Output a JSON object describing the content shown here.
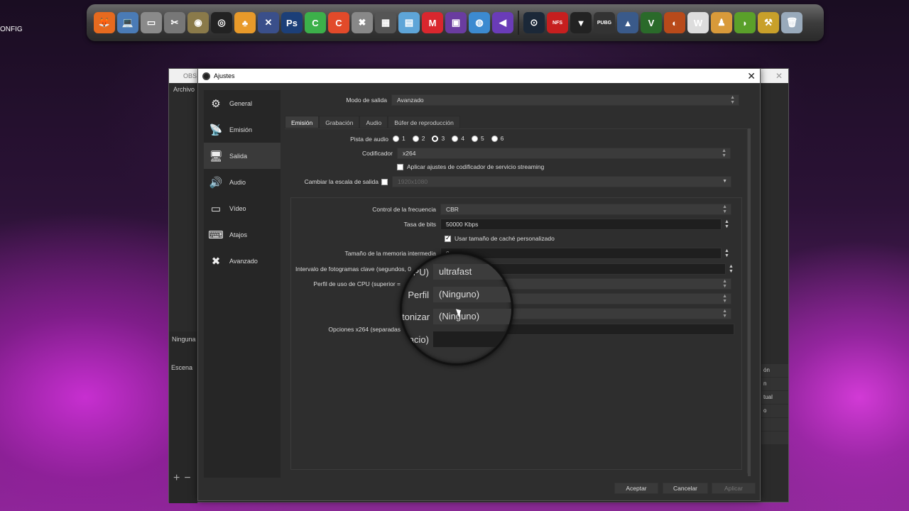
{
  "desktop": {
    "label": "ONFIG"
  },
  "dock": {
    "icons": [
      {
        "name": "firefox-icon",
        "glyph": "🦊",
        "color": "#e66a1f"
      },
      {
        "name": "laptop-icon",
        "glyph": "💻",
        "color": "#4a7bb6"
      },
      {
        "name": "drive-icon",
        "glyph": "▭",
        "color": "#8a8a8a"
      },
      {
        "name": "tools-icon",
        "glyph": "✂",
        "color": "#777"
      },
      {
        "name": "coin-icon",
        "glyph": "◉",
        "color": "#8a7a4a"
      },
      {
        "name": "obs-icon",
        "glyph": "◎",
        "color": "#222"
      },
      {
        "name": "fl-studio-icon",
        "glyph": "♣",
        "color": "#e89a2a"
      },
      {
        "name": "directx-icon",
        "glyph": "✕",
        "color": "#3a4f8a"
      },
      {
        "name": "photoshop-icon",
        "glyph": "Ps",
        "color": "#1c3f78"
      },
      {
        "name": "camtasia-icon",
        "glyph": "C",
        "color": "#3cb04a"
      },
      {
        "name": "camtasia-red-icon",
        "glyph": "C",
        "color": "#e24a2a"
      },
      {
        "name": "wrench-icon",
        "glyph": "✖",
        "color": "#888"
      },
      {
        "name": "gpu-icon",
        "glyph": "▦",
        "color": "#555"
      },
      {
        "name": "id-card-icon",
        "glyph": "▤",
        "color": "#5ea5d8"
      },
      {
        "name": "mega-icon",
        "glyph": "M",
        "color": "#d9272e"
      },
      {
        "name": "cpu-icon",
        "glyph": "▣",
        "color": "#6a3ca0"
      },
      {
        "name": "earth-icon",
        "glyph": "◍",
        "color": "#3c8ad0"
      },
      {
        "name": "visual-studio-icon",
        "glyph": "◀",
        "color": "#6a3cb8"
      },
      {
        "name": "steam-icon",
        "glyph": "⊙",
        "color": "#1b2838"
      },
      {
        "name": "nfs-icon",
        "glyph": "NFS",
        "color": "#c61f1f"
      },
      {
        "name": "fox-mask-icon",
        "glyph": "▼",
        "color": "#222"
      },
      {
        "name": "pubg-icon",
        "glyph": "PUBG",
        "color": "#333"
      },
      {
        "name": "assassins-creed-icon",
        "glyph": "▲",
        "color": "#3a5a8a"
      },
      {
        "name": "gta-icon",
        "glyph": "V",
        "color": "#2a6a2a"
      },
      {
        "name": "watch-dogs-icon",
        "glyph": "◐",
        "color": "#b84a1a"
      },
      {
        "name": "wolf-icon",
        "glyph": "W",
        "color": "#ddd"
      },
      {
        "name": "cs-icon",
        "glyph": "♟",
        "color": "#d89a3a"
      },
      {
        "name": "nvidia-icon",
        "glyph": "◗",
        "color": "#5aa02a"
      },
      {
        "name": "hammer-icon",
        "glyph": "⚒",
        "color": "#c8a02a"
      },
      {
        "name": "recycle-bin-icon",
        "glyph": "🗑",
        "color": "#9ab"
      }
    ]
  },
  "obs": {
    "title": "OBS",
    "menu_archivo": "Archivo",
    "ninguna": "Ninguna",
    "escena": "Escena",
    "right_items": [
      "ón",
      "n",
      "tual",
      "o",
      "",
      ""
    ]
  },
  "settings": {
    "title": "Ajustes",
    "categories": [
      {
        "label": "General",
        "icon": "gear-icon",
        "glyph": "⚙"
      },
      {
        "label": "Emisión",
        "icon": "broadcast-icon",
        "glyph": "📡"
      },
      {
        "label": "Salida",
        "icon": "monitor-output-icon",
        "glyph": "🖥"
      },
      {
        "label": "Audio",
        "icon": "speaker-icon",
        "glyph": "🔊"
      },
      {
        "label": "Vídeo",
        "icon": "display-icon",
        "glyph": "▭"
      },
      {
        "label": "Atajos",
        "icon": "keyboard-icon",
        "glyph": "⌨"
      },
      {
        "label": "Avanzado",
        "icon": "wrench-screwdriver-icon",
        "glyph": "✖"
      }
    ],
    "active_category": "Salida",
    "output_mode_label": "Modo de salida",
    "output_mode_value": "Avanzado",
    "tabs": [
      "Emisión",
      "Grabación",
      "Audio",
      "Búfer de reproducción"
    ],
    "audio_track_label": "Pista de audio",
    "audio_tracks": [
      "1",
      "2",
      "3",
      "4",
      "5",
      "6"
    ],
    "encoder_label": "Codificador",
    "encoder_value": "x264",
    "apply_encoder_settings": "Aplicar ajustes de codificador de servicio streaming",
    "rescale_label": "Cambiar la escala de salida",
    "rescale_value": "1920x1080",
    "rate_control_label": "Control de la frecuencia",
    "rate_control_value": "CBR",
    "bitrate_label": "Tasa de bits",
    "bitrate_value": "50000 Kbps",
    "custom_buffer_label": "Usar tamaño de caché personalizado",
    "buffer_size_label": "Tamaño de la memoria intermedia",
    "buffer_size_value": "0",
    "keyframe_label": "Intervalo de fotogramas clave (segundos, 0",
    "cpu_preset_label": "Perfil de uso de CPU (superior =",
    "x264_options_label": "Opciones x264 (separadas",
    "buttons": {
      "ok": "Aceptar",
      "cancel": "Cancelar",
      "apply": "Aplicar"
    }
  },
  "magnifier": {
    "rows": [
      {
        "label": "PU)",
        "value": "ultrafast"
      },
      {
        "label": "Perfil",
        "value": "(Ninguno)"
      },
      {
        "label": "tonizar",
        "value": "(Ninguno)"
      },
      {
        "label": "acio)",
        "value": ""
      }
    ]
  }
}
